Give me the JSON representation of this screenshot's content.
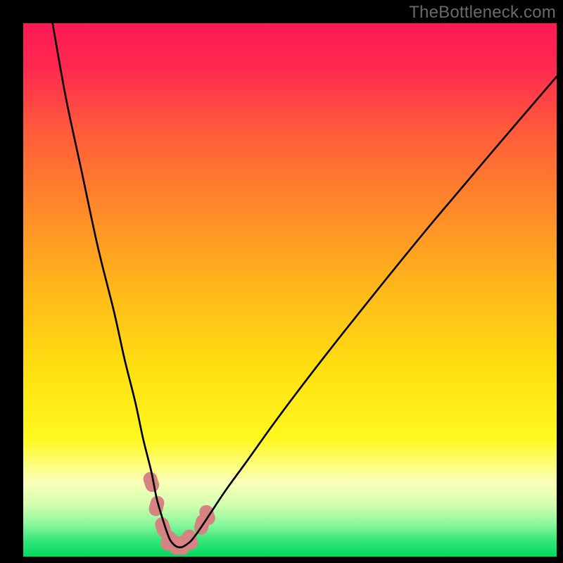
{
  "watermark": "TheBottleneck.com",
  "chart_data": {
    "type": "line",
    "title": "",
    "xlabel": "",
    "ylabel": "",
    "xlim": [
      0,
      100
    ],
    "ylim": [
      0,
      100
    ],
    "grid": false,
    "legend": false,
    "gradient_stops": [
      {
        "offset": 0.0,
        "color": "#ff1a55"
      },
      {
        "offset": 0.08,
        "color": "#ff2850"
      },
      {
        "offset": 0.2,
        "color": "#ff5a3a"
      },
      {
        "offset": 0.35,
        "color": "#ff8a2a"
      },
      {
        "offset": 0.5,
        "color": "#ffb81a"
      },
      {
        "offset": 0.65,
        "color": "#ffe010"
      },
      {
        "offset": 0.78,
        "color": "#fff820"
      },
      {
        "offset": 0.86,
        "color": "#faffb8"
      },
      {
        "offset": 0.9,
        "color": "#d6ffb0"
      },
      {
        "offset": 0.94,
        "color": "#88f79a"
      },
      {
        "offset": 0.97,
        "color": "#35e67a"
      },
      {
        "offset": 1.0,
        "color": "#00d85a"
      }
    ],
    "series": [
      {
        "name": "bottleneck-curve",
        "x": [
          5.5,
          8,
          11,
          14,
          17,
          19,
          21,
          22.5,
          24,
          25,
          26,
          26.8,
          27.5,
          28.3,
          29,
          29.8,
          30.5,
          31.5,
          33,
          35,
          38,
          42,
          47,
          53,
          60,
          68,
          77,
          88,
          100
        ],
        "y": [
          100,
          86,
          72,
          58,
          46,
          37,
          29,
          22,
          16,
          11,
          7.5,
          5,
          3.2,
          2.2,
          1.8,
          1.8,
          2.2,
          3,
          5,
          8,
          12.5,
          18,
          25,
          33,
          42,
          52,
          63,
          76,
          90
        ]
      }
    ],
    "markers": [
      {
        "x": 24.0,
        "y": 14.0,
        "color": "#d78383"
      },
      {
        "x": 25.0,
        "y": 9.5,
        "color": "#d78383"
      },
      {
        "x": 26.2,
        "y": 5.5,
        "color": "#d78383"
      },
      {
        "x": 27.2,
        "y": 3.0,
        "color": "#d78383"
      },
      {
        "x": 28.5,
        "y": 2.2,
        "color": "#d78383"
      },
      {
        "x": 30.0,
        "y": 2.2,
        "color": "#d78383"
      },
      {
        "x": 31.3,
        "y": 3.2,
        "color": "#d78383"
      },
      {
        "x": 33.5,
        "y": 6.0,
        "color": "#d78383"
      },
      {
        "x": 34.5,
        "y": 7.8,
        "color": "#d78383"
      }
    ]
  }
}
